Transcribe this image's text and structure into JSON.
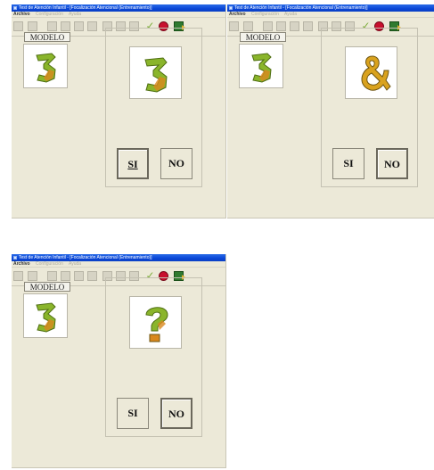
{
  "window": {
    "title": "Test de Atención Infantil - [Focalización Atencional (Entrenamiento)]",
    "menu": {
      "archivo": "Archivo",
      "configuracion": "Configuración",
      "ayuda": "Ayuda"
    }
  },
  "model_label": "MODELO",
  "buttons": {
    "yes": "SI",
    "no": "NO"
  },
  "icons": {
    "toolbar": [
      "visor-icon",
      "chart-icon",
      "grid-icon",
      "people-icon",
      "disabled-icon",
      "disabled-icon",
      "disabled-icon",
      "disabled-icon",
      "disabled-icon",
      "check-icon",
      "stop-icon",
      "exit-icon"
    ],
    "model_figure": "number-3-figure",
    "stimulus_figures": [
      "number-3-figure",
      "ampersand-figure",
      "question-mark-figure"
    ]
  },
  "colors": {
    "titlebar": "#0a46d6",
    "background": "#ece9d8",
    "figure_green": "#8ab52b",
    "figure_orange": "#d9881e"
  }
}
